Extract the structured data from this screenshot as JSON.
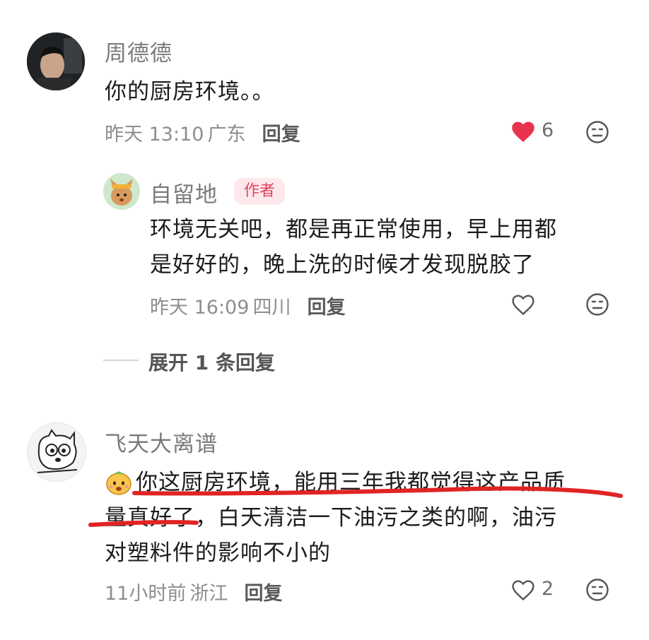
{
  "comments": [
    {
      "user": "周德德",
      "text": "你的厨房环境。。",
      "time": "昨天 13:10",
      "location": "广东",
      "reply_label": "回复",
      "likes": "6",
      "liked": true,
      "like_color": "#e8344e",
      "avatar_icon": "person-photo-avatar",
      "replies": [
        {
          "user": "自留地",
          "badge": "作者",
          "text_line1": "环境无关吧，都是再正常使用，早上用都",
          "text_line2": "是好好的，晚上洗的时候才发现脱胶了",
          "time": "昨天 16:09",
          "location": "四川",
          "reply_label": "回复",
          "avatar_icon": "cartoon-mascot-avatar"
        }
      ],
      "expand_label": "展开 1 条回复"
    },
    {
      "user": "飞天大离谱",
      "text_line1": "你这厨房环境，能用三年我都觉得这产品质",
      "text_line2": "量真好了，白天清洁一下油污之类的啊，油污",
      "text_line3": "对塑料件的影响不小的",
      "time": "11小时前",
      "location": "浙江",
      "reply_label": "回复",
      "likes": "2",
      "liked": false,
      "annotation_color": "#e02424",
      "avatar_icon": "cartoon-cat-avatar",
      "emoji_icon": "cartoon-emoji-icon"
    }
  ]
}
